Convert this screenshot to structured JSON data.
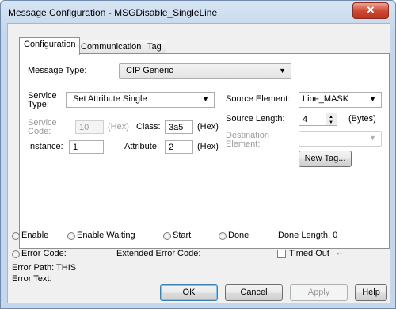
{
  "window": {
    "title": "Message Configuration - MSGDisable_SingleLine",
    "close_glyph": "✕"
  },
  "tabs": [
    {
      "label": "Configuration"
    },
    {
      "label": "Communication"
    },
    {
      "label": "Tag"
    }
  ],
  "config": {
    "message_type_label": "Message Type:",
    "message_type_value": "CIP Generic",
    "service_type_label_1": "Service",
    "service_type_label_2": "Type:",
    "service_type_value": "Set Attribute Single",
    "service_code_label_1": "Service",
    "service_code_label_2": "Code:",
    "service_code_value": "10",
    "hex_label": "(Hex)",
    "class_label": "Class:",
    "class_value": "3a5",
    "instance_label": "Instance:",
    "instance_value": "1",
    "attribute_label": "Attribute:",
    "attribute_value": "2",
    "source_element_label": "Source Element:",
    "source_element_value": "Line_MASK",
    "source_length_label": "Source Length:",
    "source_length_value": "4",
    "bytes_label": "(Bytes)",
    "destination_label_1": "Destination",
    "destination_label_2": "Element:",
    "new_tag_label": "New Tag..."
  },
  "status": {
    "enable": "Enable",
    "enable_waiting": "Enable Waiting",
    "start": "Start",
    "done": "Done",
    "done_length": "Done Length: 0",
    "error_code": "Error Code:",
    "extended_error_code": "Extended Error Code:",
    "timed_out": "Timed Out",
    "timed_out_arrow": "←",
    "error_path": "Error Path: THIS",
    "error_text": "Error Text:"
  },
  "buttons": {
    "ok": "OK",
    "cancel": "Cancel",
    "apply": "Apply",
    "help": "Help"
  },
  "colors": {
    "accent_arrow": "#1f5fd6",
    "close_button": "#cf4a33"
  }
}
